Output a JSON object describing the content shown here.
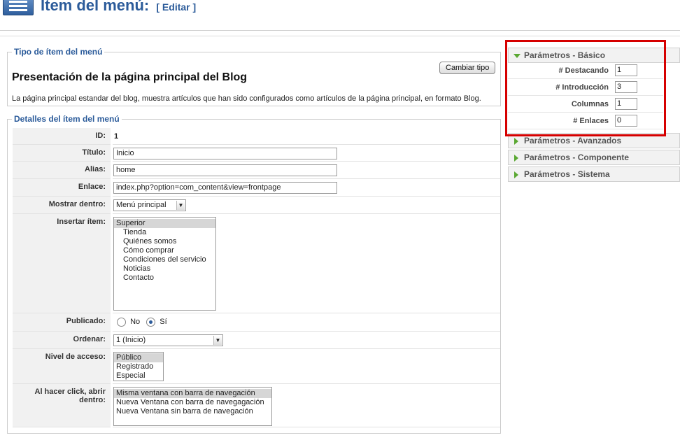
{
  "header": {
    "title": "Ítem del menú:",
    "edit": "[ Editar ]"
  },
  "type_section": {
    "legend": "Tipo de ítem del menú",
    "change_button": "Cambiar tipo",
    "title": "Presentación de la página principal del Blog",
    "description": "La página principal estandar del blog, muestra artículos que han sido configurados como artículos de la página principal, en formato Blog."
  },
  "details": {
    "legend": "Detalles del ítem del menú",
    "id": {
      "label": "ID:",
      "value": "1"
    },
    "title": {
      "label": "Título:",
      "value": "Inicio"
    },
    "alias": {
      "label": "Alias:",
      "value": "home"
    },
    "link": {
      "label": "Enlace:",
      "value": "index.php?option=com_content&view=frontpage"
    },
    "show_in": {
      "label": "Mostrar dentro:",
      "value": "Menú principal"
    },
    "insert_item": {
      "label": "Insertar ítem:",
      "options": [
        "Superior",
        "Tienda",
        "Quiénes somos",
        "Cómo comprar",
        "Condiciones del servicio",
        "Noticias",
        "Contacto"
      ]
    },
    "published": {
      "label": "Publicado:",
      "no": "No",
      "yes": "Sí",
      "selected": "Sí"
    },
    "order": {
      "label": "Ordenar:",
      "value": "1 (Inicio)"
    },
    "access": {
      "label": "Nivel de acceso:",
      "options": [
        "Público",
        "Registrado",
        "Especial"
      ]
    },
    "on_click": {
      "label_line1": "Al hacer click, abrir",
      "label_line2": "dentro:",
      "options": [
        "Misma ventana con barra de navegación",
        "Nueva Ventana con barra de navegagación",
        "Nueva Ventana sin barra de navegación"
      ]
    }
  },
  "params": {
    "basic": {
      "title": "Parámetros - Básico",
      "rows": [
        {
          "label": "# Destacando",
          "value": "1"
        },
        {
          "label": "# Introducción",
          "value": "3"
        },
        {
          "label": "Columnas",
          "value": "1"
        },
        {
          "label": "# Enlaces",
          "value": "0"
        }
      ]
    },
    "advanced": "Parámetros - Avanzados",
    "component": "Parámetros - Componente",
    "system": "Parámetros - Sistema"
  },
  "colors": {
    "accent": "#2b5b9a",
    "highlight_box": "#d60000",
    "toggle": "#5aa832"
  }
}
